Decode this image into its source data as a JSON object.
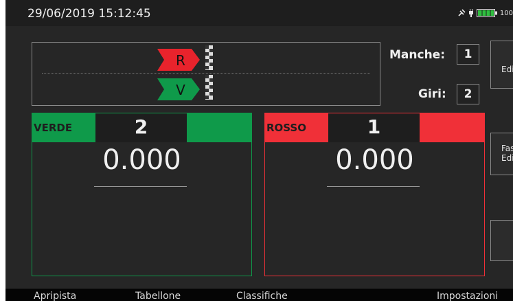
{
  "status_bar": {
    "datetime": "29/06/2019  15:12:45",
    "battery_percent": "100"
  },
  "track": {
    "lanes": [
      {
        "letter": "R",
        "color": "#e8232c"
      },
      {
        "letter": "V",
        "color": "#0f9a4a"
      }
    ]
  },
  "race_info": {
    "manche_label": "Manche:",
    "manche_value": "1",
    "giri_label": "Giri:",
    "giri_value": "2"
  },
  "side_buttons": [
    {
      "label": "Edi"
    },
    {
      "label_line1": "Fas",
      "label_line2": "Edi"
    },
    {
      "label": ""
    }
  ],
  "panels": [
    {
      "name": "VERDE",
      "count": "2",
      "time": "0.000",
      "color": "#0f9a4a"
    },
    {
      "name": "ROSSO",
      "count": "1",
      "time": "0.000",
      "color": "#f03038"
    }
  ],
  "bottom_tabs": [
    "Apripista",
    "Tabellone",
    "Classifiche",
    "Impostazioni"
  ]
}
